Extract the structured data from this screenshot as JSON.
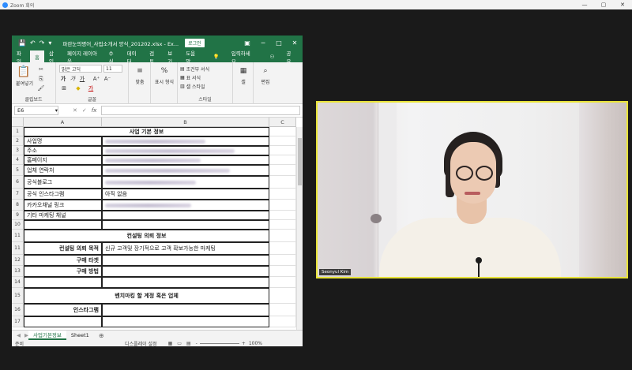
{
  "zoom": {
    "title": "Zoom 회의",
    "min": "—",
    "max": "▢",
    "close": "✕"
  },
  "excel": {
    "filename": "파란눈의명어_사업소개서 양식_201202.xlsx  -  Ex...",
    "login_label": "로그인",
    "menu_tabs": [
      {
        "label": "파일"
      },
      {
        "label": "홈"
      },
      {
        "label": "삽입"
      },
      {
        "label": "페이지 레이아웃"
      },
      {
        "label": "수식"
      },
      {
        "label": "데이터"
      },
      {
        "label": "검토"
      },
      {
        "label": "보기"
      },
      {
        "label": "도움말"
      }
    ],
    "tell_me": "입력하세요",
    "share": "공유",
    "ribbon": {
      "clipboard_label": "클립보드",
      "paste_label": "붙여넣기",
      "font_group_label": "글꼴",
      "font_name": "맑은 고딕",
      "font_size": "11",
      "bold": "가",
      "italic": "가",
      "underline": "가",
      "align_label": "맞춤",
      "number_label": "표시 형식",
      "cond_format": "조건부 서식",
      "table_format": "표 서식",
      "cell_style": "셀 스타일",
      "style_group_label": "스타일",
      "cells_label": "셀",
      "edit_label": "편집"
    },
    "name_box": "E6",
    "col_headers": [
      "A",
      "B",
      "C"
    ],
    "rows": [
      {
        "num": "1",
        "a": "",
        "b": "사업 기본 정보",
        "type": "section"
      },
      {
        "num": "2",
        "a": "사업명",
        "b": "",
        "type": "blur"
      },
      {
        "num": "3",
        "a": "주소",
        "b": "",
        "type": "blur"
      },
      {
        "num": "4",
        "a": "홈페이지",
        "b": "",
        "type": "blur"
      },
      {
        "num": "5",
        "a": "업체 연락처",
        "b": "",
        "type": "blur"
      },
      {
        "num": "6",
        "a": "공식블로그",
        "b": "",
        "type": "blur"
      },
      {
        "num": "7",
        "a": "공식 인스타그램",
        "b": "아직 없음",
        "type": "text"
      },
      {
        "num": "8",
        "a": "카카오채널 링크",
        "b": "",
        "type": "blur"
      },
      {
        "num": "9",
        "a": "기타 마케팅 채널",
        "b": "",
        "type": "text"
      },
      {
        "num": "10",
        "a": "",
        "b": "",
        "type": "empty"
      },
      {
        "num": "11",
        "a": "",
        "b": "컨설팅 의뢰 정보",
        "type": "section"
      },
      {
        "num": "11",
        "a": "컨설팅 의뢰 목적",
        "b": "신규 고객및 장기적으로 고객 확보가능한 마케팅",
        "type": "right"
      },
      {
        "num": "12",
        "a": "구매 타겟",
        "b": "",
        "type": "right"
      },
      {
        "num": "13",
        "a": "구매 방법",
        "b": "",
        "type": "right"
      },
      {
        "num": "14",
        "a": "",
        "b": "",
        "type": "right"
      },
      {
        "num": "15",
        "a": "",
        "b": "벤치마킹 할 계정 혹은 업체",
        "type": "section"
      },
      {
        "num": "16",
        "a": "인스타그램",
        "b": "",
        "type": "right"
      },
      {
        "num": "17",
        "a": "",
        "b": "",
        "type": "right"
      }
    ],
    "sheet_tabs": [
      {
        "label": "사업기본정보"
      },
      {
        "label": "Sheet1"
      }
    ],
    "status": {
      "ready": "준비",
      "display": "디스플레이 설정",
      "zoom": "100%",
      "plus": "+",
      "minus": "-"
    }
  },
  "video": {
    "participant_name": "Seonyul Kim"
  }
}
